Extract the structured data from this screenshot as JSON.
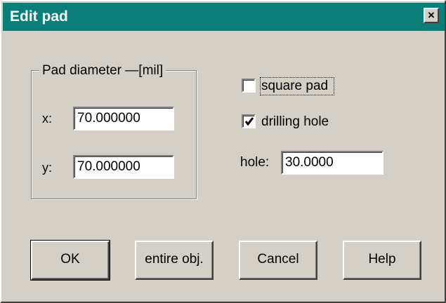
{
  "window": {
    "title": "Edit pad",
    "close_label": "×"
  },
  "group": {
    "legend": "Pad diameter —[mil]",
    "x_label": "x:",
    "x_value": "70.000000",
    "y_label": "y:",
    "y_value": "70.000000"
  },
  "options": {
    "square_pad_label": "square pad",
    "square_pad_checked": false,
    "drilling_hole_label": "drilling hole",
    "drilling_hole_checked": true,
    "hole_label": "hole:",
    "hole_value": "30.0000"
  },
  "buttons": {
    "ok": "OK",
    "entire": "entire obj.",
    "cancel": "Cancel",
    "help": "Help"
  },
  "colors": {
    "titlebar": "#0a7f7a",
    "face": "#d4d0c8"
  }
}
